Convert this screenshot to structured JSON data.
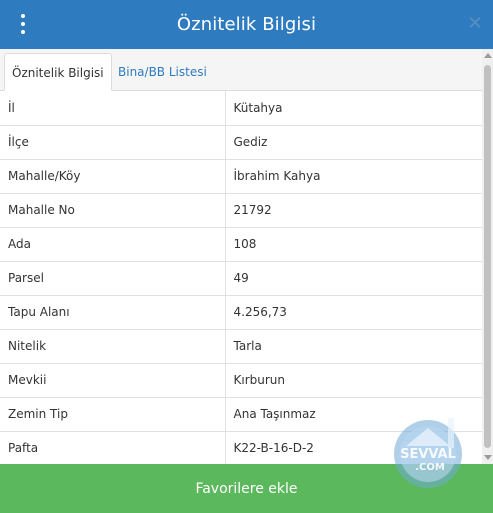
{
  "header": {
    "title": "Öznitelik Bilgisi",
    "menu_icon": "vertical-ellipsis-icon",
    "close_icon": "close-icon",
    "background": "#2f7bbf"
  },
  "tabs": [
    {
      "label": "Öznitelik Bilgisi",
      "active": true
    },
    {
      "label": "Bina/BB Listesi",
      "active": false
    }
  ],
  "attributes": [
    {
      "key": "İl",
      "value": "Kütahya"
    },
    {
      "key": "İlçe",
      "value": "Gediz"
    },
    {
      "key": "Mahalle/Köy",
      "value": "İbrahim Kahya"
    },
    {
      "key": "Mahalle No",
      "value": "21792"
    },
    {
      "key": "Ada",
      "value": "108"
    },
    {
      "key": "Parsel",
      "value": "49"
    },
    {
      "key": "Tapu Alanı",
      "value": "4.256,73"
    },
    {
      "key": "Nitelik",
      "value": "Tarla"
    },
    {
      "key": "Mevkii",
      "value": "Kırburun"
    },
    {
      "key": "Zemin Tip",
      "value": "Ana Taşınmaz"
    },
    {
      "key": "Pafta",
      "value": "K22-B-16-D-2"
    }
  ],
  "footer": {
    "button_label": "Favorilere ekle",
    "background": "#5cb85c"
  },
  "watermark": {
    "text_top": "SEVVAL",
    "text_bottom": ".COM"
  }
}
